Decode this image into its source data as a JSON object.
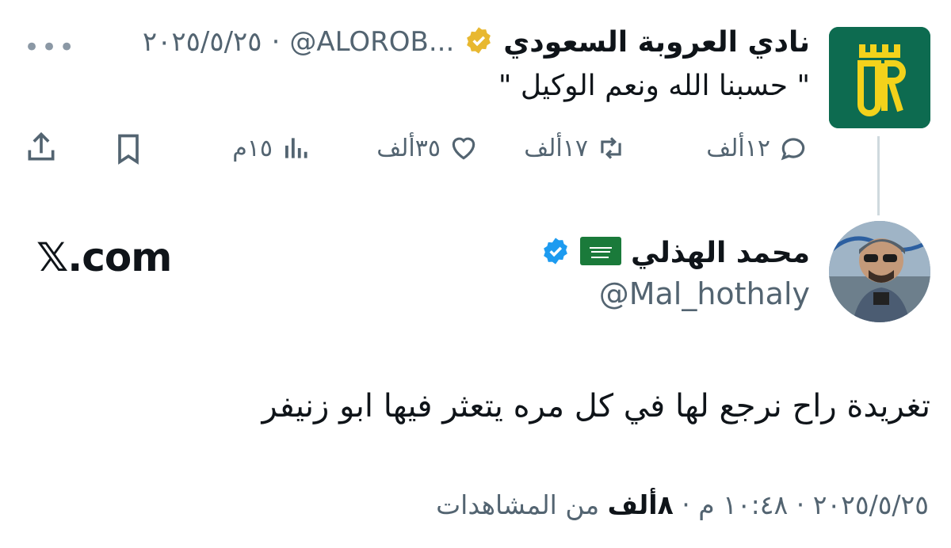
{
  "quoted_tweet": {
    "name": "نادي العروبة السعودي",
    "handle": "@ALOROB...",
    "separator": "·",
    "date": "٢٠٢٥/٥/٢٥",
    "more": "•••",
    "text": "\" حسبنا الله ونعم الوكيل \"",
    "actions": {
      "replies": "١٢ألف",
      "retweets": "١٧ألف",
      "likes": "٣٥ألف",
      "views": "١٥م"
    }
  },
  "tweet": {
    "name": "محمد الهذلي",
    "handle": "@Mal_hothaly",
    "text": "تغريدة راح نرجع لها في كل مره يتعثر فيها ابو زنيفر",
    "meta_prefix": "٢٠٢٥/٥/٢٥ · ١٠:٤٨ م · ",
    "views_count": "٨ألف",
    "views_suffix": " من المشاهدات"
  },
  "watermark": "𝕏.com",
  "colors": {
    "verified_gold": "#e8b830",
    "verified_blue": "#1d9bf0",
    "club_green": "#0d6b50",
    "club_yellow": "#f3d21b",
    "muted": "#536471"
  },
  "icons": [
    "reply-icon",
    "retweet-icon",
    "like-icon",
    "views-icon",
    "bookmark-icon",
    "share-icon",
    "verified-badge-icon",
    "saudi-flag-icon"
  ]
}
